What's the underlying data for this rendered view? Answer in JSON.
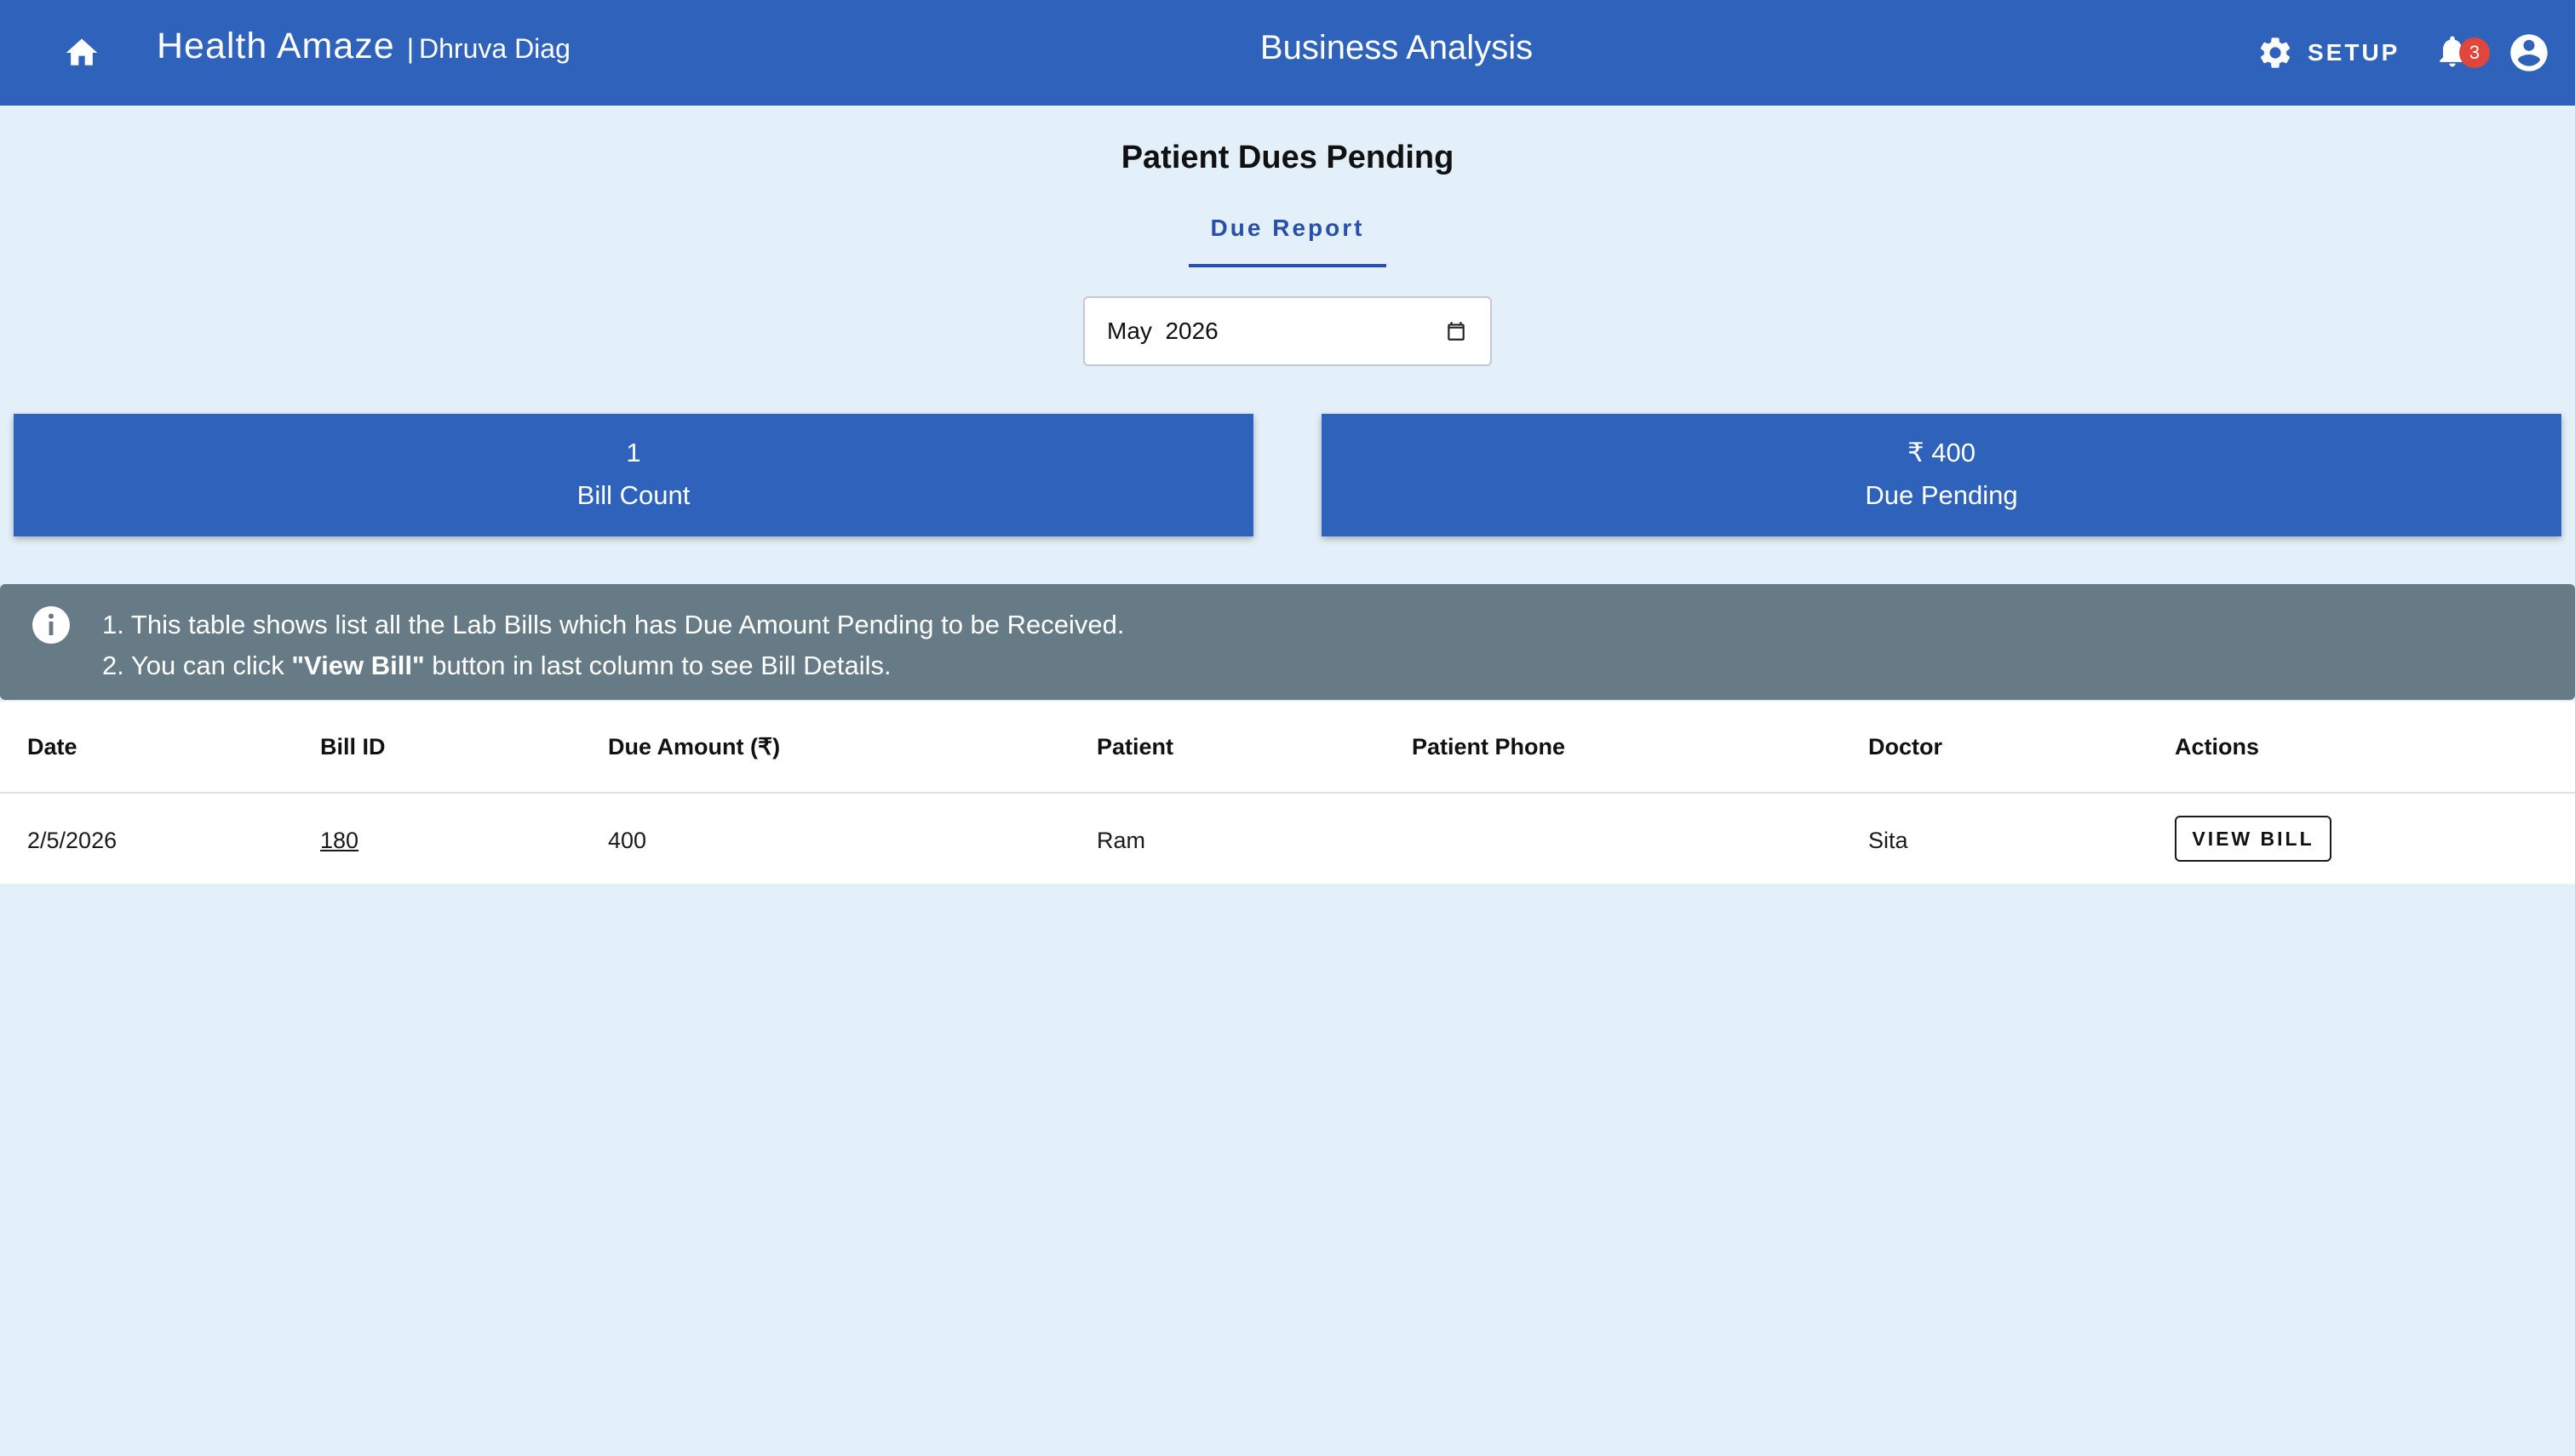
{
  "header": {
    "brand_name": "Health Amaze",
    "brand_separator": "|",
    "org_name": "Dhruva Diag",
    "page_title": "Business Analysis",
    "setup_label": "SETUP",
    "notification_count": "3",
    "icons": [
      "home-icon",
      "gear-icon",
      "bell-icon",
      "account-circle-icon"
    ]
  },
  "report": {
    "title": "Patient Dues Pending",
    "tabs": [
      {
        "label": "Due Report",
        "active": true
      }
    ]
  },
  "month_picker": {
    "value": "May  2026",
    "icon": "calendar-icon"
  },
  "stats": [
    {
      "value": "1",
      "label": "Bill Count"
    },
    {
      "value": "₹ 400",
      "label": "Due Pending"
    }
  ],
  "info": {
    "icon": "info-icon",
    "line1": "1. This table shows list all the Lab Bills which has Due Amount Pending to be Received.",
    "line2_prefix": "2. You can click ",
    "line2_bold": "\"View Bill\"",
    "line2_suffix": " button in last column to see Bill Details."
  },
  "table": {
    "columns": [
      "Date",
      "Bill ID",
      "Due Amount (₹)",
      "Patient",
      "Patient Phone",
      "Doctor",
      "Actions"
    ],
    "rows": [
      {
        "date": "2/5/2026",
        "bill_id": "180",
        "due_amount": "400",
        "patient": "Ram",
        "patient_phone": "",
        "doctor": "Sita",
        "action_label": "VIEW BILL"
      }
    ]
  },
  "colors": {
    "primary": "#2f62bb",
    "background": "#e3f0fa",
    "info_banner": "#667b86",
    "badge": "#e0463b",
    "link": "#1a1ad6",
    "tab_active": "#2850a8"
  }
}
